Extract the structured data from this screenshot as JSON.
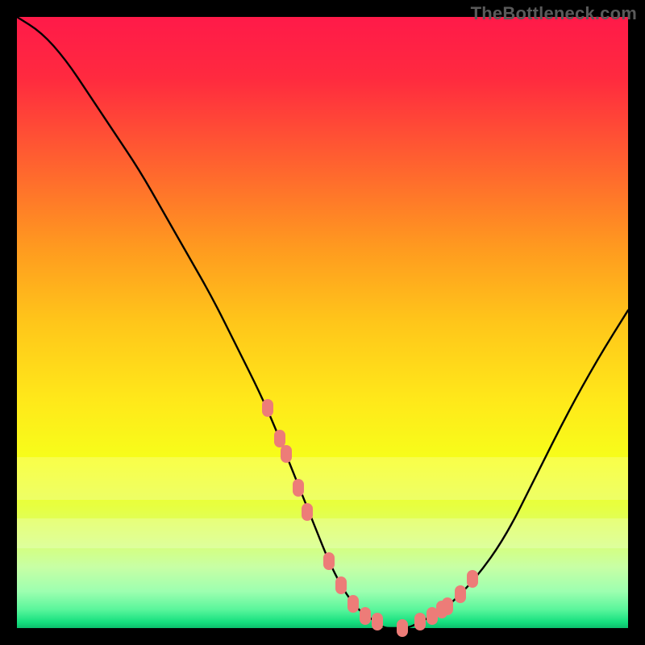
{
  "watermark": "TheBottleneck.com",
  "colors": {
    "frame_bg": "#000000",
    "gradient_top": "#ff1a49",
    "gradient_bottom": "#0cc06c",
    "curve_stroke": "#000000",
    "marker_fill": "#ed7c78"
  },
  "chart_data": {
    "type": "line",
    "title": "",
    "xlabel": "",
    "ylabel": "",
    "xlim": [
      0,
      100
    ],
    "ylim": [
      0,
      100
    ],
    "grid": false,
    "legend": false,
    "series": [
      {
        "name": "bottleneck-curve",
        "x": [
          0,
          4,
          8,
          12,
          16,
          20,
          24,
          28,
          32,
          36,
          40,
          43,
          45,
          47,
          49,
          51,
          53,
          55,
          57,
          59,
          60,
          62,
          64,
          66,
          70,
          75,
          80,
          85,
          90,
          95,
          100
        ],
        "y": [
          100,
          97.5,
          93,
          87,
          81,
          75,
          68,
          61,
          54,
          46,
          38,
          31,
          26,
          21,
          16,
          11,
          7,
          4,
          2,
          1,
          0,
          0,
          0,
          1,
          3,
          8,
          15,
          25,
          35,
          44,
          52
        ]
      }
    ],
    "markers": {
      "name": "highlighted-points",
      "x": [
        41,
        43,
        44,
        46,
        47.5,
        51,
        53,
        55,
        57,
        59,
        63,
        66,
        68,
        69.5,
        70.5,
        72.5,
        74.5
      ],
      "y": [
        36,
        31,
        28.5,
        23,
        19,
        11,
        7,
        4,
        2,
        1,
        0,
        1,
        2,
        3,
        3.5,
        5.5,
        8
      ]
    },
    "pale_bands_y": [
      [
        21,
        28
      ],
      [
        13,
        18
      ]
    ],
    "annotations": []
  }
}
